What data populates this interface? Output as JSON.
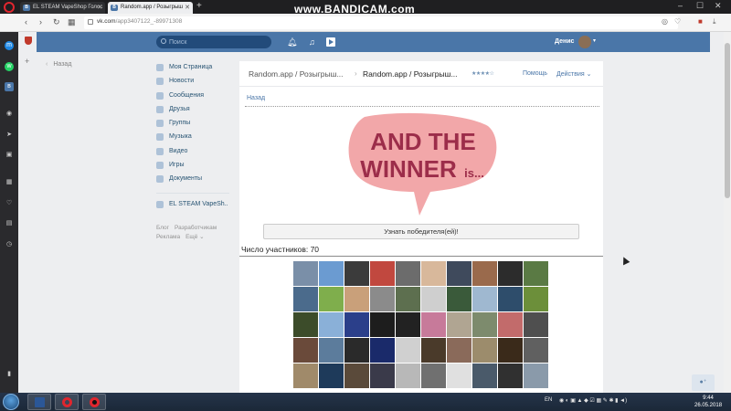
{
  "browser": {
    "tabs": [
      {
        "title": "EL STEAM VapeShop Голос",
        "active": false
      },
      {
        "title": "Random.app / Розыгрыш",
        "active": true
      }
    ],
    "new_tab": "+",
    "watermark": "www.BANDICAM.com",
    "url_domain": "vk.com",
    "url_path": "/app3407122_-89971308",
    "window_controls": {
      "minimize": "–",
      "maximize": "☐",
      "close": "✕"
    }
  },
  "opera_sidebar": {
    "icons": [
      "messenger-icon",
      "whatsapp-icon",
      "vk-icon",
      "add-icon",
      "camera-icon",
      "send-icon",
      "screenshot-icon",
      "apps-icon",
      "heart-icon",
      "news-icon",
      "history-icon",
      "sidebar-toggle-icon"
    ]
  },
  "vk_header": {
    "search_placeholder": "Поиск",
    "user_name": "Денис",
    "accent": "#4a76a8"
  },
  "back_link": "Назад",
  "left_menu": {
    "items": [
      "Моя Страница",
      "Новости",
      "Сообщения",
      "Друзья",
      "Группы",
      "Музыка",
      "Видео",
      "Игры",
      "Документы"
    ],
    "extra_item": "EL STEAM VapeSh..",
    "footer": {
      "blog": "Блог",
      "developers": "Разработчикам",
      "ads": "Реклама",
      "more": "Ещё ⌄"
    }
  },
  "app": {
    "breadcrumb_1": "Random.app / Розыгрыш...",
    "breadcrumb_2": "Random.app / Розыгрыш...",
    "stars": "★★★★☆",
    "help": "Помощь",
    "actions": "Действия ⌄",
    "back": "Назад",
    "winner_image_line1": "AND THE",
    "winner_image_line2": "WINNER",
    "winner_image_line3": "is...",
    "winner_button": "Узнать победителя(ей)!",
    "participants_label": "Число участников: 70",
    "avatar_colors": [
      "#7a8fa8",
      "#6b9bd1",
      "#3b3b3b",
      "#c1483f",
      "#6c6c6c",
      "#d8b89b",
      "#3f4a5c",
      "#9a6a4c",
      "#2c2c2c",
      "#5a7a44",
      "#4b6b8c",
      "#7fae4c",
      "#c9a07a",
      "#8b8b8b",
      "#5d6f4f",
      "#cfcfcf",
      "#3a5a3a",
      "#9fb8d0",
      "#2e4d6b",
      "#6c8f3a",
      "#3c4c2a",
      "#8ab0d8",
      "#2b3f8a",
      "#1d1d1d",
      "#222222",
      "#c77a9a",
      "#b0a592",
      "#7d8b6d",
      "#c26b6b",
      "#4f4f4f",
      "#6a4a3a",
      "#5c7c9c",
      "#2a2a2a",
      "#1a2a6a",
      "#d0d0d0",
      "#4a3a2a",
      "#8a6a5a",
      "#9c8c6c",
      "#3a2a1a",
      "#606060",
      "#a08a6a",
      "#1e3a5a",
      "#5a4a3a",
      "#3a3a4a",
      "#b8b8b8",
      "#707070",
      "#e0e0e0",
      "#4a5a6a",
      "#303030",
      "#8a9aaa"
    ]
  },
  "taskbar": {
    "lang": "EN",
    "time": "9:44",
    "date": "26.05.2018"
  }
}
